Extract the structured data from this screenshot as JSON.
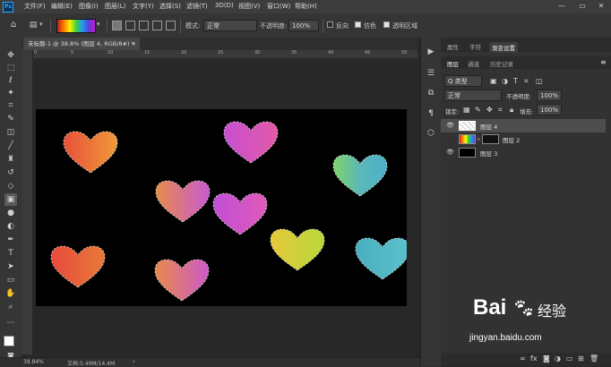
{
  "app": {
    "logo": "Ps"
  },
  "menu": [
    "文件(F)",
    "编辑(E)",
    "图像(I)",
    "图层(L)",
    "文字(Y)",
    "选择(S)",
    "滤镜(T)",
    "3D(D)",
    "视图(V)",
    "窗口(W)",
    "帮助(H)"
  ],
  "options": {
    "mode_label": "模式:",
    "mode_value": "正常",
    "opacity_label": "不透明度:",
    "opacity_value": "100%",
    "reverse_label": "反向",
    "dither_label": "仿色",
    "transparency_label": "透明区域"
  },
  "document_tab": "未标题-1 @ 38.8% (图层 4, RGB/8#) *",
  "ruler_top": [
    "0",
    "5",
    "10",
    "15",
    "20",
    "25",
    "30",
    "35",
    "40",
    "45",
    "50"
  ],
  "status": {
    "zoom": "38.84%",
    "doc": "文档:5.49M/14.4M"
  },
  "panel": {
    "top_tabs": [
      "属性",
      "字符",
      "渐变设置"
    ],
    "layer_tabs": [
      "图层",
      "通道",
      "历史记录"
    ],
    "kind_label": "Q 类型",
    "blend_mode": "正常",
    "opacity_label": "不透明度:",
    "opacity_value": "100%",
    "lock_label": "锁定:",
    "fill_label": "填充:",
    "fill_value": "100%",
    "layers": [
      {
        "name": "图层 4"
      },
      {
        "name": "图层 2"
      },
      {
        "name": "图层 3"
      }
    ]
  },
  "watermark": {
    "brand": "Bai",
    "brand2": "经验",
    "url": "jingyan.baidu.com"
  },
  "colors": {
    "accent": "#31a8ff",
    "canvas": "#000000"
  }
}
